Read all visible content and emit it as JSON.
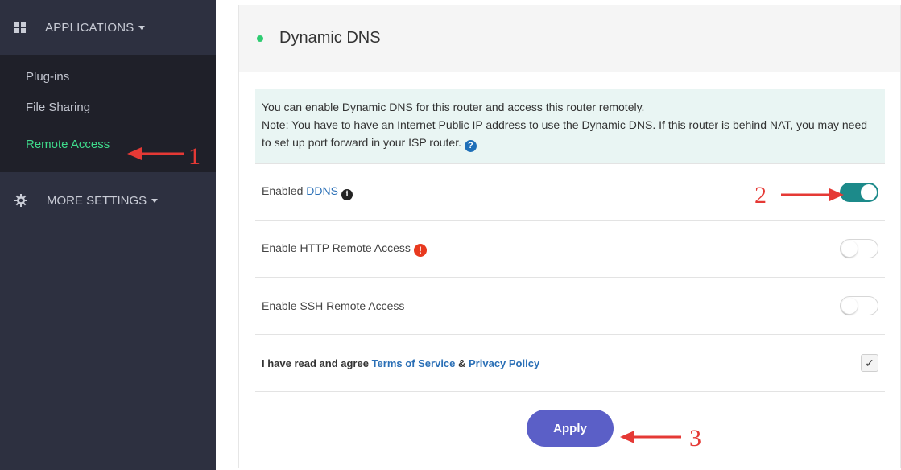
{
  "sidebar": {
    "applications_label": "APPLICATIONS",
    "items": [
      {
        "label": "Plug-ins"
      },
      {
        "label": "File Sharing"
      },
      {
        "label": "Remote Access"
      }
    ],
    "more_settings_label": "MORE SETTINGS"
  },
  "panel": {
    "title": "Dynamic DNS",
    "info_line1": "You can enable Dynamic DNS for this router and access this router remotely.",
    "info_line2": "Note: You have to have an Internet Public IP address to use the Dynamic DNS. If this router is behind NAT, you may need to set up port forward in your ISP router.",
    "ddns_prefix": "Enabled ",
    "ddns_link": "DDNS",
    "http_label": "Enable HTTP Remote Access",
    "ssh_label": "Enable SSH Remote Access",
    "agree_prefix": "I have read and agree ",
    "terms_link": "Terms of Service",
    "agree_amp": " & ",
    "privacy_link": "Privacy Policy",
    "apply_label": "Apply"
  },
  "toggles": {
    "ddns_enabled": true,
    "http_enabled": false,
    "ssh_enabled": false
  },
  "agree_checked": true,
  "annotations": [
    "1",
    "2",
    "3"
  ],
  "colors": {
    "sidebar_bg": "#2d3040",
    "active_item": "#3fdc8c",
    "toggle_on": "#1c8a8a",
    "apply_button": "#5b5fc7",
    "annotation": "#e53935"
  }
}
